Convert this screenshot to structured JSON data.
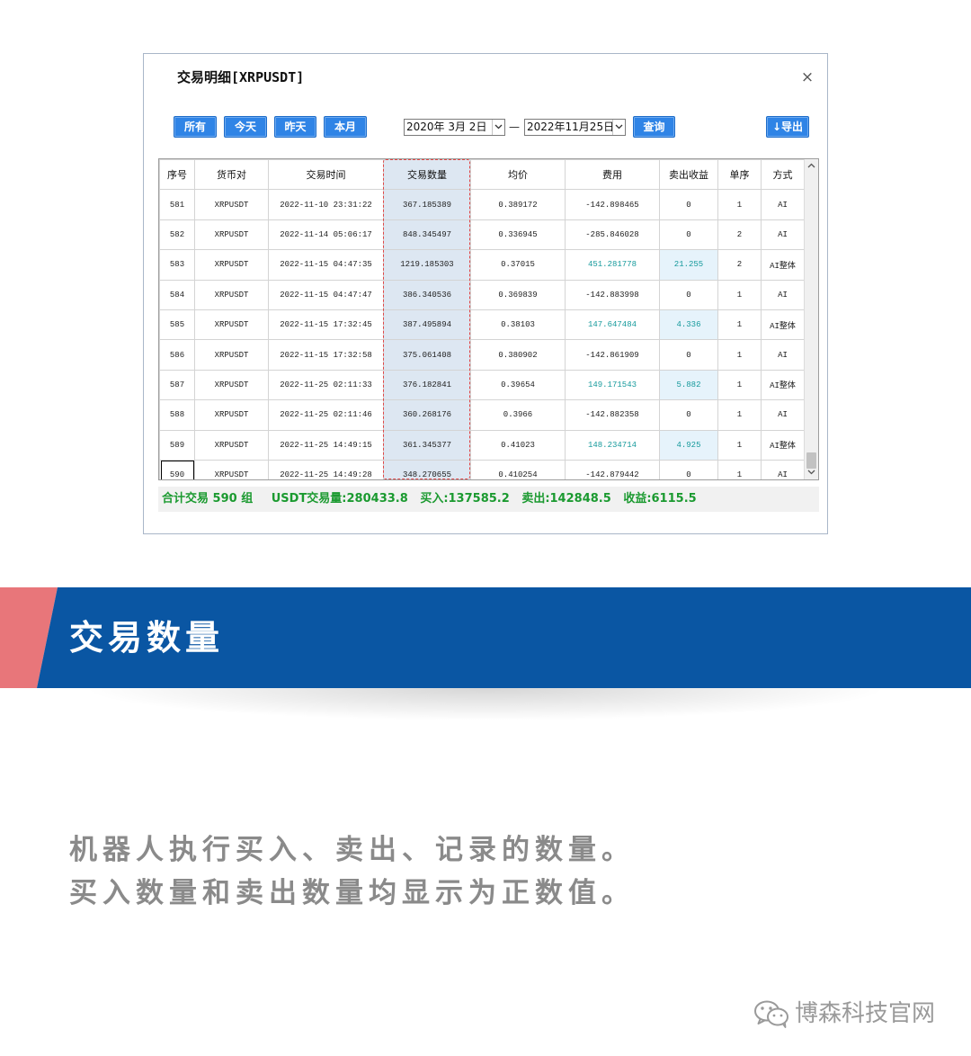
{
  "colors": {
    "button_blue": "#2f84e6",
    "banner_blue": "#0a56a3",
    "banner_pink": "#e8767a",
    "positive_teal": "#169a9c",
    "summary_green": "#1b9a30",
    "highlight_red": "#e04848",
    "highlight_fill": "#dde7f2",
    "text_gray": "#8a8a8a"
  },
  "icons": [
    "close-icon",
    "chevron-down-icon",
    "scroll-up-icon",
    "scroll-down-icon",
    "wechat-icon"
  ],
  "dialog": {
    "title": "交易明细[XRPUSDT]",
    "close_glyph": "×",
    "filters": [
      "所有",
      "今天",
      "昨天",
      "本月"
    ],
    "date_from": "2020年 3月 2日",
    "date_separator": "—",
    "date_to": "2022年11月25日",
    "query_label": "查询",
    "export_label": "↓导出",
    "columns": [
      "序号",
      "货币对",
      "交易时间",
      "交易数量",
      "均价",
      "费用",
      "卖出收益",
      "单序",
      "方式"
    ],
    "rows": [
      [
        "581",
        "XRPUSDT",
        "2022-11-10 23:31:22",
        "367.185389",
        "0.389172",
        "-142.898465",
        "0",
        "1",
        "AI"
      ],
      [
        "582",
        "XRPUSDT",
        "2022-11-14 05:06:17",
        "848.345497",
        "0.336945",
        "-285.846028",
        "0",
        "2",
        "AI"
      ],
      [
        "583",
        "XRPUSDT",
        "2022-11-15 04:47:35",
        "1219.185303",
        "0.37015",
        "451.281778",
        "21.255",
        "2",
        "AI整体"
      ],
      [
        "584",
        "XRPUSDT",
        "2022-11-15 04:47:47",
        "386.340536",
        "0.369839",
        "-142.883998",
        "0",
        "1",
        "AI"
      ],
      [
        "585",
        "XRPUSDT",
        "2022-11-15 17:32:45",
        "387.495894",
        "0.38103",
        "147.647484",
        "4.336",
        "1",
        "AI整体"
      ],
      [
        "586",
        "XRPUSDT",
        "2022-11-15 17:32:58",
        "375.061408",
        "0.380902",
        "-142.861909",
        "0",
        "1",
        "AI"
      ],
      [
        "587",
        "XRPUSDT",
        "2022-11-25 02:11:33",
        "376.182841",
        "0.39654",
        "149.171543",
        "5.882",
        "1",
        "AI整体"
      ],
      [
        "588",
        "XRPUSDT",
        "2022-11-25 02:11:46",
        "360.268176",
        "0.3966",
        "-142.882358",
        "0",
        "1",
        "AI"
      ],
      [
        "589",
        "XRPUSDT",
        "2022-11-25 14:49:15",
        "361.345377",
        "0.41023",
        "148.234714",
        "4.925",
        "1",
        "AI整体"
      ],
      [
        "590",
        "XRPUSDT",
        "2022-11-25 14:49:28",
        "348.270655",
        "0.410254",
        "-142.879442",
        "0",
        "1",
        "AI"
      ]
    ],
    "summary": {
      "count": "合计交易 590 组",
      "volume": "USDT交易量:280433.8",
      "buy": "买入:137585.2",
      "sell": "卖出:142848.5",
      "profit": "收益:6115.5"
    }
  },
  "banner": {
    "title": "交易数量"
  },
  "description": [
    "机器人执行买入、卖出、记录的数量。",
    "买入数量和卖出数量均显示为正数值。"
  ],
  "watermark": {
    "text": "博森科技官网"
  }
}
